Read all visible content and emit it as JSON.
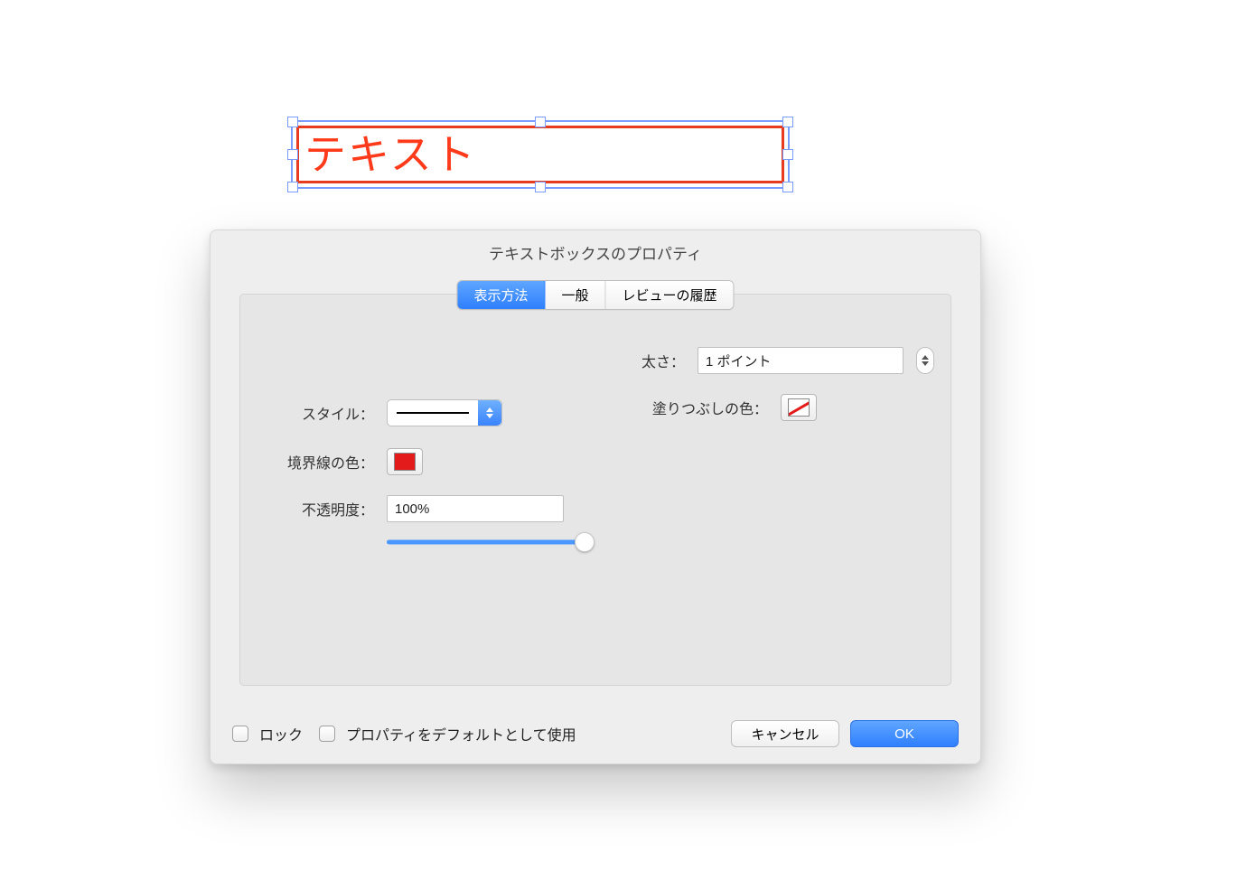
{
  "canvas": {
    "textbox_text": "テキスト"
  },
  "dialog": {
    "title": "テキストボックスのプロパティ",
    "tabs": {
      "display": "表示方法",
      "general": "一般",
      "history": "レビューの履歴"
    },
    "labels": {
      "style": "スタイル：",
      "border_color": "境界線の色：",
      "opacity": "不透明度：",
      "thickness": "太さ：",
      "fill_color": "塗りつぶしの色："
    },
    "values": {
      "opacity": "100%",
      "thickness": "1 ポイント"
    },
    "footer": {
      "lock": "ロック",
      "use_default": "プロパティをデフォルトとして使用",
      "cancel": "キャンセル",
      "ok": "OK"
    },
    "colors": {
      "border": "#e31b1b",
      "fill": "none"
    }
  }
}
